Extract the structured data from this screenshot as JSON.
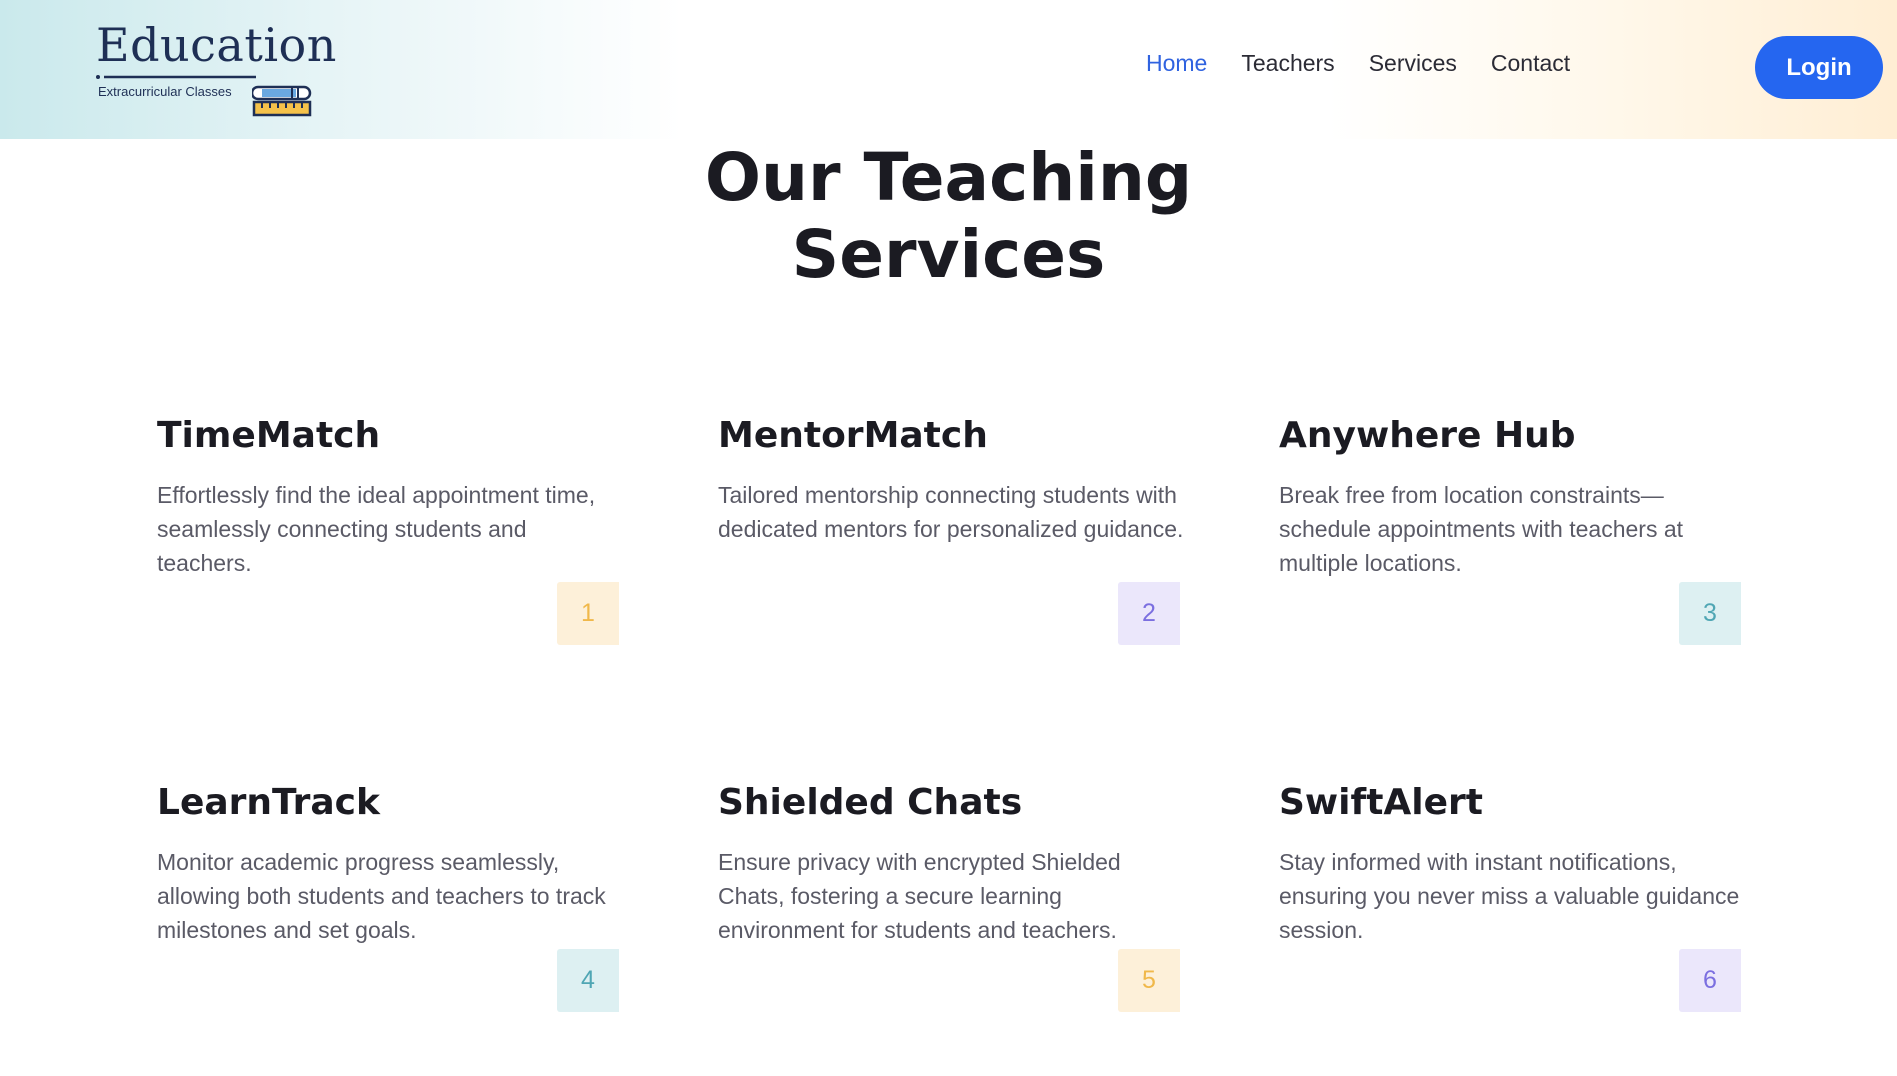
{
  "logo": {
    "title": "Education",
    "subtitle": "Extracurricular Classes"
  },
  "nav": {
    "items": [
      {
        "label": "Home",
        "active": true
      },
      {
        "label": "Teachers",
        "active": false
      },
      {
        "label": "Services",
        "active": false
      },
      {
        "label": "Contact",
        "active": false
      }
    ],
    "login_label": "Login"
  },
  "section": {
    "title_line1": "Our Teaching",
    "title_line2": "Services"
  },
  "services": [
    {
      "title": "TimeMatch",
      "desc": "Effortlessly find the ideal appointment time, seamlessly connecting students and teachers.",
      "num": "1",
      "num_bg": "#fdf0d9",
      "num_color": "#f0b84a"
    },
    {
      "title": "MentorMatch",
      "desc": "Tailored mentorship connecting students with dedicated mentors for personalized guidance.",
      "num": "2",
      "num_bg": "#ebe7fb",
      "num_color": "#7b6fe0"
    },
    {
      "title": "Anywhere Hub",
      "desc": "Break free from location constraints—schedule appointments with teachers at multiple locations.",
      "num": "3",
      "num_bg": "#ddf0f2",
      "num_color": "#4fa6b4"
    },
    {
      "title": "LearnTrack",
      "desc": "Monitor academic progress seamlessly, allowing both students and teachers to track milestones and set goals.",
      "num": "4",
      "num_bg": "#ddf0f2",
      "num_color": "#4fa6b4"
    },
    {
      "title": "Shielded Chats",
      "desc": "Ensure privacy with encrypted Shielded Chats, fostering a secure learning environment for students and teachers.",
      "num": "5",
      "num_bg": "#fdf0d9",
      "num_color": "#f0b84a"
    },
    {
      "title": "SwiftAlert",
      "desc": "Stay informed with instant notifications, ensuring you never miss a valuable guidance session.",
      "num": "6",
      "num_bg": "#ebe7fb",
      "num_color": "#7b6fe0"
    }
  ]
}
